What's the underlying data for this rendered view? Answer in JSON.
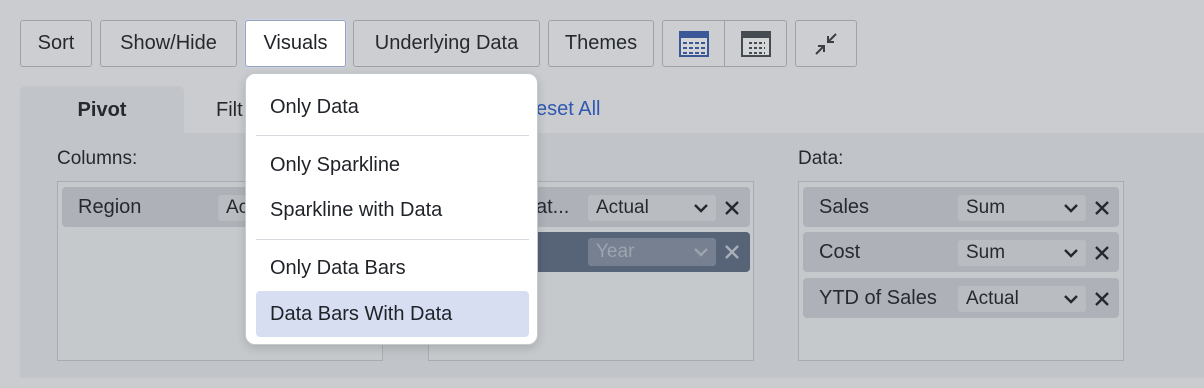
{
  "toolbar": {
    "buttons": [
      {
        "label": "Sort"
      },
      {
        "label": "Show/Hide"
      },
      {
        "label": "Visuals"
      },
      {
        "label": "Underlying Data"
      },
      {
        "label": "Themes"
      }
    ],
    "icons": [
      "table-view-icon",
      "compact-table-icon",
      "collapse-icon"
    ]
  },
  "tabs": {
    "pivot": "Pivot",
    "filter_partial": "Filt",
    "reset_partial": "eset All"
  },
  "columns": {
    "label": "Columns:",
    "chip_name": "Region",
    "chip_agg_partial": "Ac"
  },
  "rows": {
    "chip1_partial": "at...",
    "chip1_agg": "Actual",
    "chip2_agg": "Year"
  },
  "data_section": {
    "label": "Data:",
    "items": [
      {
        "name": "Sales",
        "agg": "Sum"
      },
      {
        "name": "Cost",
        "agg": "Sum"
      },
      {
        "name": "YTD of Sales",
        "agg": "Actual"
      }
    ]
  },
  "visuals_menu": {
    "items": [
      {
        "label": "Only Data"
      },
      {
        "label": "Only Sparkline"
      },
      {
        "label": "Sparkline with Data"
      },
      {
        "label": "Only Data Bars"
      },
      {
        "label": "Data Bars With Data"
      }
    ],
    "selected": "Data Bars With Data"
  },
  "colors": {
    "accent": "#2f5fd0",
    "selected_item": "#d7def2",
    "dark_chip": "#5f6e86"
  }
}
